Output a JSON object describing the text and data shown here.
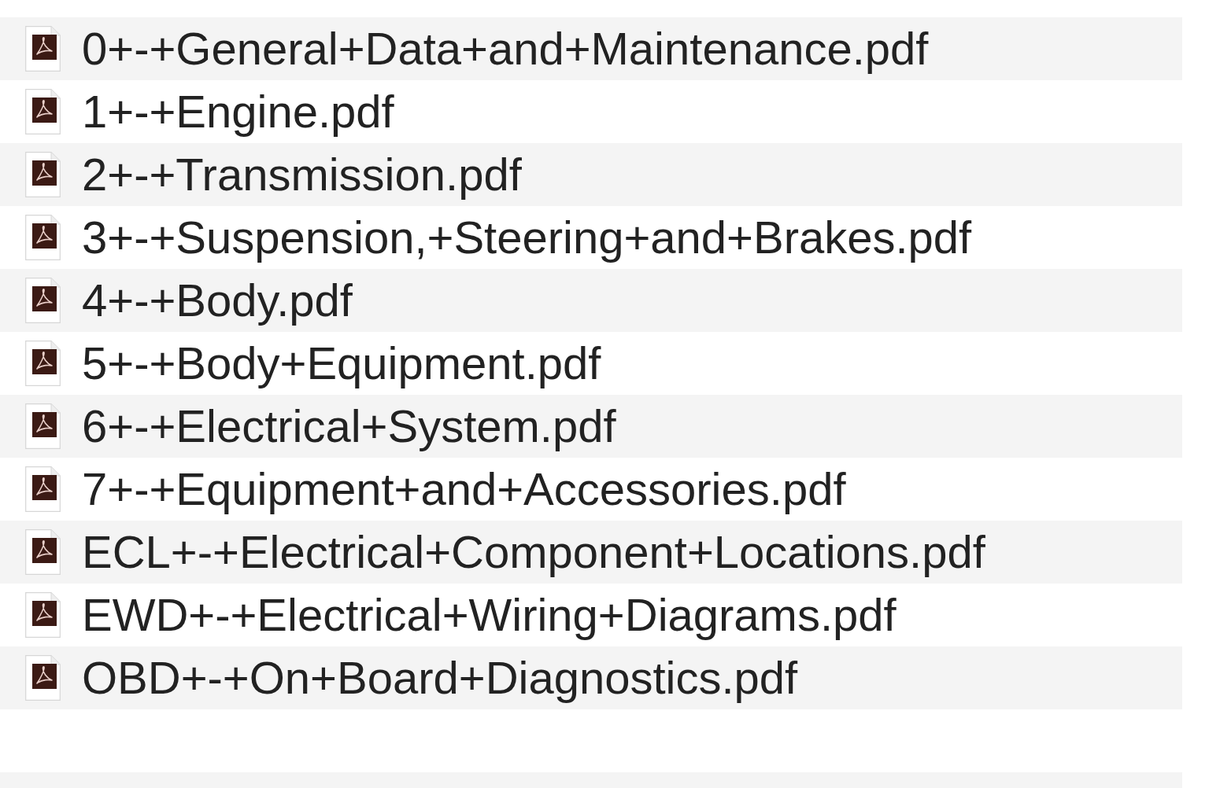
{
  "files": [
    {
      "name": "0+-+General+Data+and+Maintenance.pdf"
    },
    {
      "name": "1+-+Engine.pdf"
    },
    {
      "name": "2+-+Transmission.pdf"
    },
    {
      "name": "3+-+Suspension,+Steering+and+Brakes.pdf"
    },
    {
      "name": "4+-+Body.pdf"
    },
    {
      "name": "5+-+Body+Equipment.pdf"
    },
    {
      "name": "6+-+Electrical+System.pdf"
    },
    {
      "name": "7+-+Equipment+and+Accessories.pdf"
    },
    {
      "name": "ECL+-+Electrical+Component+Locations.pdf"
    },
    {
      "name": "EWD+-+Electrical+Wiring+Diagrams.pdf"
    },
    {
      "name": "OBD+-+On+Board+Diagnostics.pdf"
    }
  ]
}
